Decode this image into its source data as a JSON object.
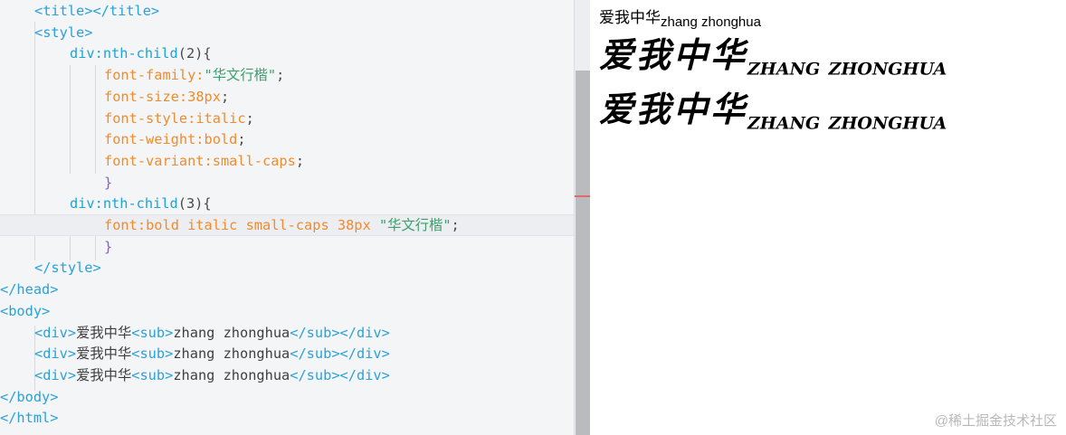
{
  "editor": {
    "lines": [
      [
        [
          "t-tag",
          "<title></title>"
        ]
      ],
      [
        [
          "t-tag",
          "<style>"
        ]
      ],
      [
        [
          "t-sel",
          "div:nth-child"
        ],
        [
          "t-punc",
          "(2){"
        ]
      ],
      [
        [
          "t-prop",
          "font-family:"
        ],
        [
          "t-str",
          "\"华文行楷\""
        ],
        [
          "t-punc",
          ";"
        ]
      ],
      [
        [
          "t-prop",
          "font-size:"
        ],
        [
          "t-val",
          "38px"
        ],
        [
          "t-punc",
          ";"
        ]
      ],
      [
        [
          "t-prop",
          "font-style:"
        ],
        [
          "t-val",
          "italic"
        ],
        [
          "t-punc",
          ";"
        ]
      ],
      [
        [
          "t-prop",
          "font-weight:"
        ],
        [
          "t-val",
          "bold"
        ],
        [
          "t-punc",
          ";"
        ]
      ],
      [
        [
          "t-prop",
          "font-variant:"
        ],
        [
          "t-val",
          "small-caps"
        ],
        [
          "t-punc",
          ";"
        ]
      ],
      [
        [
          "t-brace",
          "}"
        ]
      ],
      [
        [
          "t-sel",
          "div:nth-child"
        ],
        [
          "t-punc",
          "(3){"
        ]
      ],
      [
        [
          "t-prop",
          "font:"
        ],
        [
          "t-val",
          "bold italic small-caps 38px "
        ],
        [
          "t-str",
          "\"华文行楷\""
        ],
        [
          "t-punc",
          ";"
        ]
      ],
      [
        [
          "t-brace",
          "}"
        ]
      ],
      [
        [
          "t-tag",
          "</style>"
        ]
      ],
      [
        [
          "t-tag",
          "</head>"
        ]
      ],
      [
        [
          "t-tag",
          "<body>"
        ]
      ],
      [
        [
          "t-tag",
          "<div>"
        ],
        [
          "t-text",
          "爱我中华"
        ],
        [
          "t-tag",
          "<sub>"
        ],
        [
          "t-text",
          "zhang zhonghua"
        ],
        [
          "t-tag",
          "</sub></div>"
        ]
      ],
      [
        [
          "t-tag",
          "<div>"
        ],
        [
          "t-text",
          "爱我中华"
        ],
        [
          "t-tag",
          "<sub>"
        ],
        [
          "t-text",
          "zhang zhonghua"
        ],
        [
          "t-tag",
          "</sub></div>"
        ]
      ],
      [
        [
          "t-tag",
          "<div>"
        ],
        [
          "t-text",
          "爱我中华"
        ],
        [
          "t-tag",
          "<sub>"
        ],
        [
          "t-text",
          "zhang zhonghua"
        ],
        [
          "t-tag",
          "</sub></div>"
        ]
      ],
      [
        [
          "t-tag",
          "</body>"
        ]
      ],
      [
        [
          "t-tag",
          "</html>"
        ]
      ]
    ]
  },
  "preview": {
    "divs": [
      {
        "main": "爱我中华",
        "sub": "zhang zhonghua"
      },
      {
        "main": "爱我中华",
        "sub": "zhang zhonghua"
      },
      {
        "main": "爱我中华",
        "sub": "zhang zhonghua"
      }
    ]
  },
  "watermark": "@稀土掘金技术社区"
}
